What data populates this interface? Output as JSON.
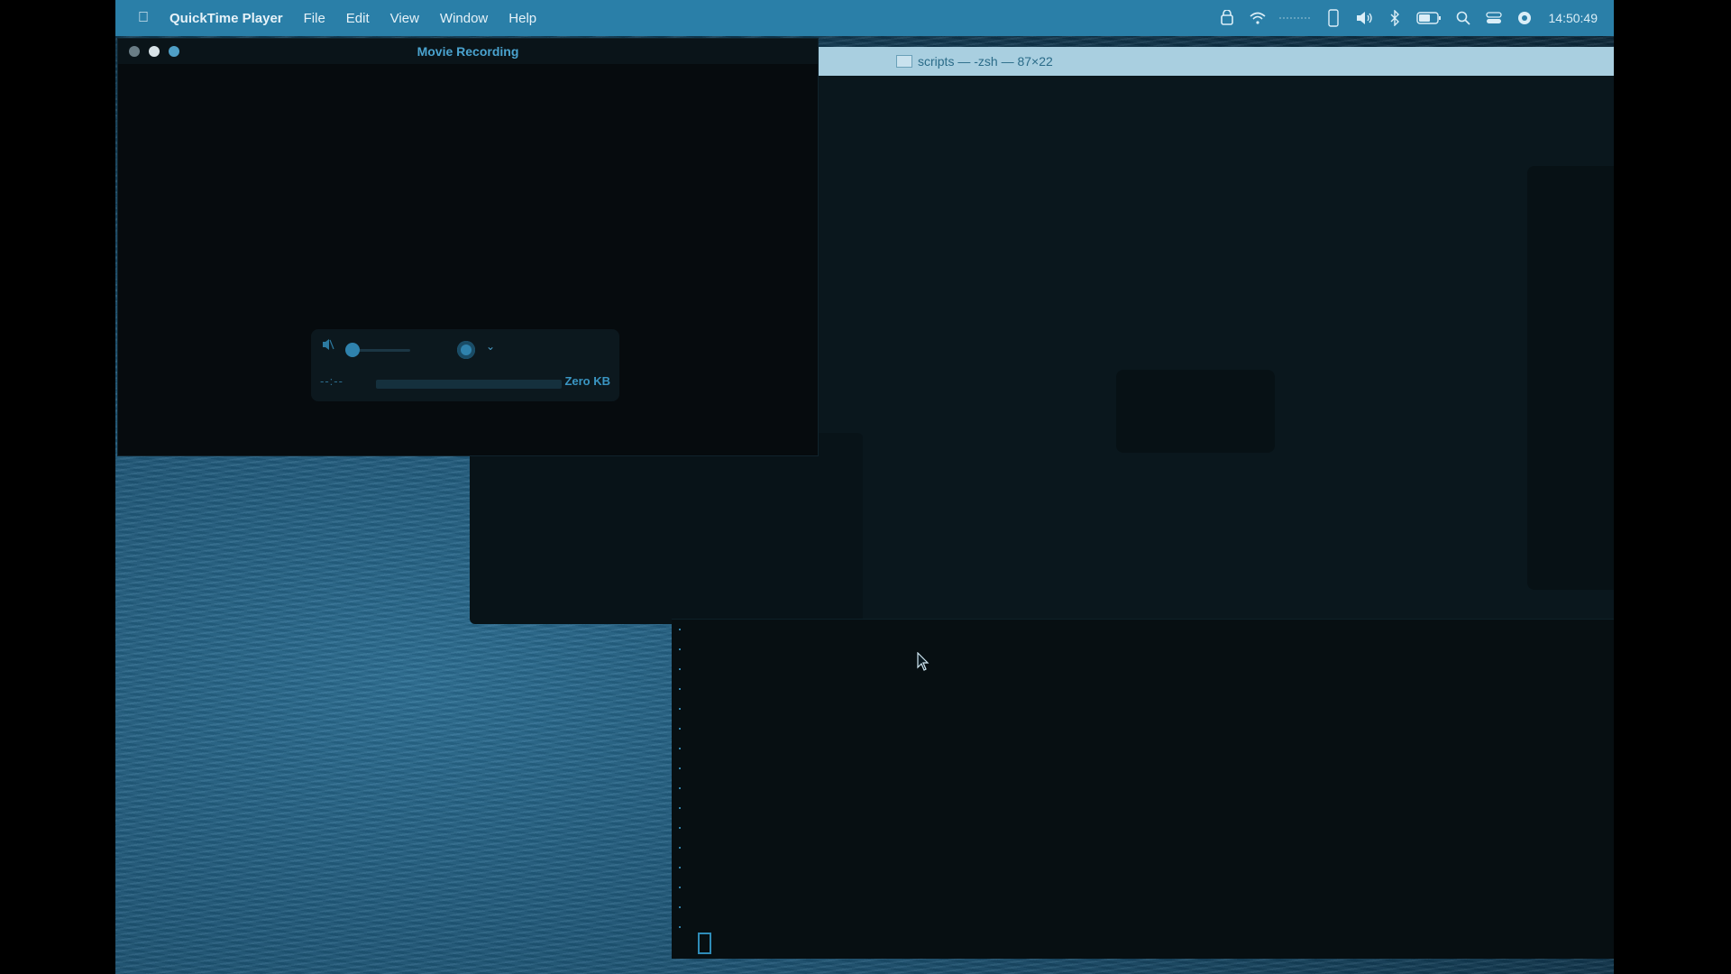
{
  "menubar": {
    "apple_icon": "apple-icon",
    "app_name": "QuickTime Player",
    "menus": [
      "File",
      "Edit",
      "View",
      "Window",
      "Help"
    ],
    "status_icons": [
      "user-lock-icon",
      "wifi-icon",
      "keyboard-layout-icon",
      "phone-icon",
      "volume-icon",
      "bluetooth-icon",
      "battery-icon",
      "search-icon",
      "control-center-icon",
      "siri-icon"
    ],
    "clock": "14:50:49"
  },
  "movie_window": {
    "title": "Movie Recording",
    "controls": {
      "elapsed": "--:--",
      "file_size": "Zero KB"
    }
  },
  "terminal_window": {
    "title": "scripts — -zsh — 87×22"
  },
  "colors": {
    "menubar": "#2a7fa8",
    "accent": "#2f82ad"
  }
}
